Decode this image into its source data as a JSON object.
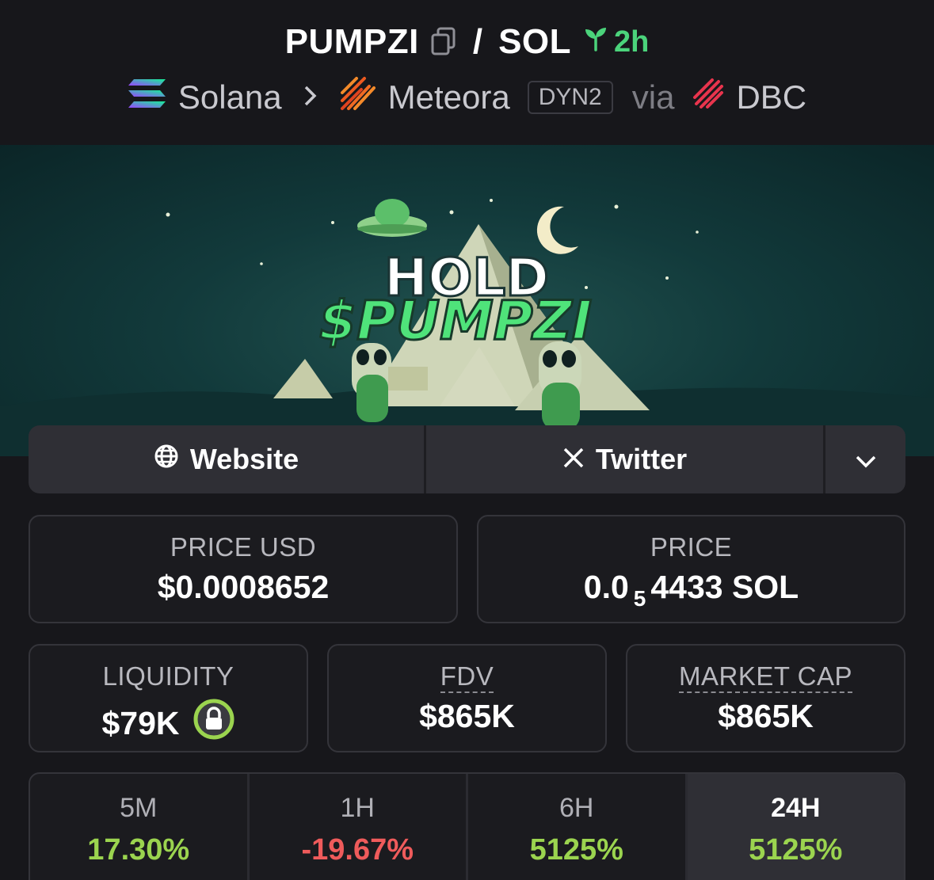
{
  "header": {
    "token": "PUMPZI",
    "quote": "SOL",
    "age": "2h",
    "chain": "Solana",
    "dex": "Meteora",
    "dex_badge": "DYN2",
    "via_label": "via",
    "via_source": "DBC"
  },
  "banner": {
    "line1": "HOLD",
    "line2": "$PUMPZI"
  },
  "links": {
    "website_label": "Website",
    "twitter_label": "Twitter"
  },
  "stats": {
    "price_usd_label": "PRICE USD",
    "price_usd_value": "$0.0008652",
    "price_label": "PRICE",
    "price_prefix": "0.0",
    "price_subscript": "5",
    "price_suffix": "4433 SOL",
    "liquidity_label": "LIQUIDITY",
    "liquidity_value": "$79K",
    "fdv_label": "FDV",
    "fdv_value": "$865K",
    "mcap_label": "MARKET CAP",
    "mcap_value": "$865K"
  },
  "timeframes": [
    {
      "label": "5M",
      "value": "17.30%"
    },
    {
      "label": "1H",
      "value": "-19.67%"
    },
    {
      "label": "6H",
      "value": "5125%"
    },
    {
      "label": "24H",
      "value": "5125%"
    }
  ],
  "colors": {
    "positive": "#9bd44f",
    "negative": "#ef5b5b",
    "age_green": "#4bd37b",
    "lock_ring": "#9bd44f"
  }
}
